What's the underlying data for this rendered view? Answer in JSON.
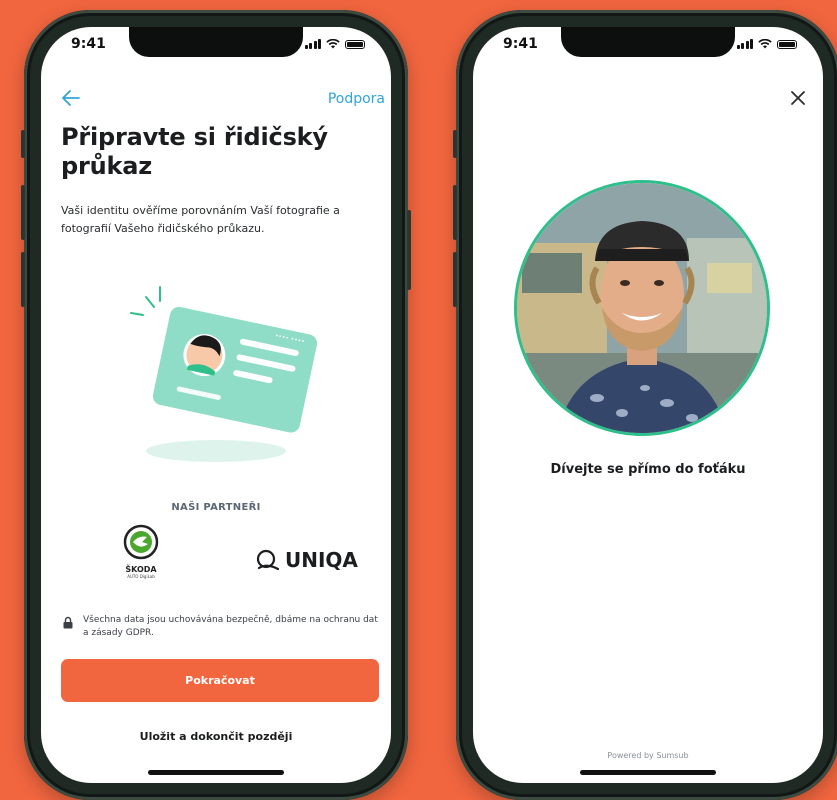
{
  "status_bar": {
    "time": "9:41"
  },
  "left_screen": {
    "back_icon": "arrow-left-icon",
    "support_link": "Podpora",
    "title": "Připravte si řidičský průkaz",
    "description": "Vaši identitu ověříme porovnáním Vaší fotografie a fotografií Vašeho řidičského průkazu.",
    "partners_title": "NAŠI PARTNEŘI",
    "partners": [
      {
        "name": "ŠKODA",
        "subtitle": "AUTO DigiLab"
      },
      {
        "name": "UNIQA"
      }
    ],
    "gdpr_text": "Všechna data jsou uchovávána bezpečně, dbáme na ochranu dat a zásady GDPR.",
    "continue_button": "Pokračovat",
    "later_link": "Uložit a dokončit později"
  },
  "right_screen": {
    "close_icon": "close-icon",
    "instruction": "Dívejte se přímo do foťáku",
    "powered_by": "Powered by Sumsub"
  },
  "colors": {
    "background": "#F2663F",
    "accent": "#F2663F",
    "link": "#2FA5D6",
    "card": "#8FDDC6",
    "avatar_ring": "#2EBF8A"
  }
}
